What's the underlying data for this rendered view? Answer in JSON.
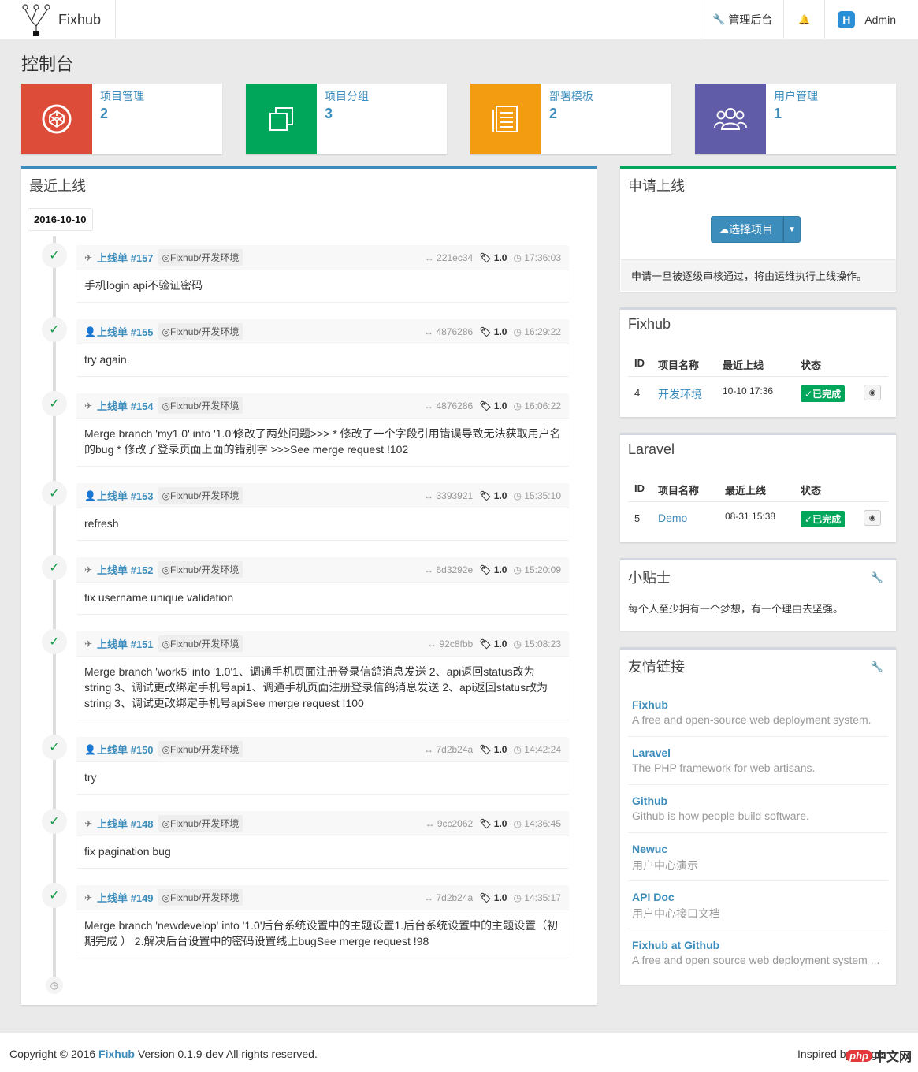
{
  "navbar": {
    "brand": "Fixhub",
    "admin_link": "管理后台",
    "user": "Admin",
    "user_initial": "H"
  },
  "page": {
    "title": "控制台"
  },
  "info_boxes": [
    {
      "label": "项目管理",
      "number": "2",
      "color": "#dd4b39",
      "icon": "codepen-icon"
    },
    {
      "label": "项目分组",
      "number": "3",
      "color": "#00a65a",
      "icon": "clone-icon"
    },
    {
      "label": "部署模板",
      "number": "2",
      "color": "#f39c12",
      "icon": "list-icon"
    },
    {
      "label": "用户管理",
      "number": "1",
      "color": "#605ca8",
      "icon": "users-icon"
    }
  ],
  "recent": {
    "title": "最近上线",
    "date": "2016-10-10",
    "items": [
      {
        "type": "plane",
        "ticket": "上线单 #157",
        "env": "◎Fixhub/开发环境",
        "commit": "221ec34",
        "version": "1.0",
        "time": "17:36:03",
        "message": "手机login api不验证密码"
      },
      {
        "type": "user",
        "ticket": "上线单 #155",
        "env": "◎Fixhub/开发环境",
        "commit": "4876286",
        "version": "1.0",
        "time": "16:29:22",
        "message": "try again."
      },
      {
        "type": "plane",
        "ticket": "上线单 #154",
        "env": "◎Fixhub/开发环境",
        "commit": "4876286",
        "version": "1.0",
        "time": "16:06:22",
        "message": "Merge branch 'my1.0' into '1.0'修改了两处问题>>> * 修改了一个字段引用错误导致无法获取用户名的bug * 修改了登录页面上面的错别字 >>>See merge request !102"
      },
      {
        "type": "user",
        "ticket": "上线单 #153",
        "env": "◎Fixhub/开发环境",
        "commit": "3393921",
        "version": "1.0",
        "time": "15:35:10",
        "message": "refresh"
      },
      {
        "type": "plane",
        "ticket": "上线单 #152",
        "env": "◎Fixhub/开发环境",
        "commit": "6d3292e",
        "version": "1.0",
        "time": "15:20:09",
        "message": "fix username unique validation"
      },
      {
        "type": "plane",
        "ticket": "上线单 #151",
        "env": "◎Fixhub/开发环境",
        "commit": "92c8fbb",
        "version": "1.0",
        "time": "15:08:23",
        "message": "Merge branch 'work5' into '1.0'1、调通手机页面注册登录信鸽消息发送 2、api返回status改为string 3、调试更改绑定手机号api1、调通手机页面注册登录信鸽消息发送 2、api返回status改为string 3、调试更改绑定手机号apiSee merge request !100"
      },
      {
        "type": "user",
        "ticket": "上线单 #150",
        "env": "◎Fixhub/开发环境",
        "commit": "7d2b24a",
        "version": "1.0",
        "time": "14:42:24",
        "message": "try"
      },
      {
        "type": "plane",
        "ticket": "上线单 #148",
        "env": "◎Fixhub/开发环境",
        "commit": "9cc2062",
        "version": "1.0",
        "time": "14:36:45",
        "message": "fix pagination bug"
      },
      {
        "type": "plane",
        "ticket": "上线单 #149",
        "env": "◎Fixhub/开发环境",
        "commit": "7d2b24a",
        "version": "1.0",
        "time": "14:35:17",
        "message": "Merge branch 'newdevelop' into '1.0'后台系统设置中的主题设置1.后台系统设置中的主题设置（初期完成 ） 2.解决后台设置中的密码设置线上bugSee merge request !98"
      }
    ]
  },
  "apply": {
    "title": "申请上线",
    "button": "选择项目",
    "note": "申请一旦被逐级审核通过，将由运维执行上线操作。"
  },
  "groups": [
    {
      "title": "Fixhub",
      "headers": [
        "ID",
        "项目名称",
        "最近上线",
        "状态"
      ],
      "row": {
        "id": "4",
        "name": "开发环境",
        "last": "10-10 17:36",
        "status": "已完成"
      }
    },
    {
      "title": "Laravel",
      "headers": [
        "ID",
        "项目名称",
        "最近上线",
        "状态"
      ],
      "row": {
        "id": "5",
        "name": "Demo",
        "last": "08-31 15:38",
        "status": "已完成"
      }
    }
  ],
  "tips": {
    "title": "小贴士",
    "text": "每个人至少拥有一个梦想，有一个理由去坚强。"
  },
  "links": {
    "title": "友情链接",
    "items": [
      {
        "name": "Fixhub",
        "desc": "A free and open-source web deployment system."
      },
      {
        "name": "Laravel",
        "desc": "The PHP framework for web artisans."
      },
      {
        "name": "Github",
        "desc": "Github is how people build software."
      },
      {
        "name": "Newuc",
        "desc": "用户中心演示"
      },
      {
        "name": "API Doc",
        "desc": "用户中心接口文档"
      },
      {
        "name": "Fixhub at Github",
        "desc": "A free and open source web deployment system ..."
      }
    ]
  },
  "footer": {
    "copyright": "Copyright © 2016",
    "brand": "Fixhub",
    "version": "Version 0.1.9-dev All rights reserved.",
    "inspired": "Inspired by Forge",
    "watermark": "中文网",
    "watermark_php": "php"
  }
}
